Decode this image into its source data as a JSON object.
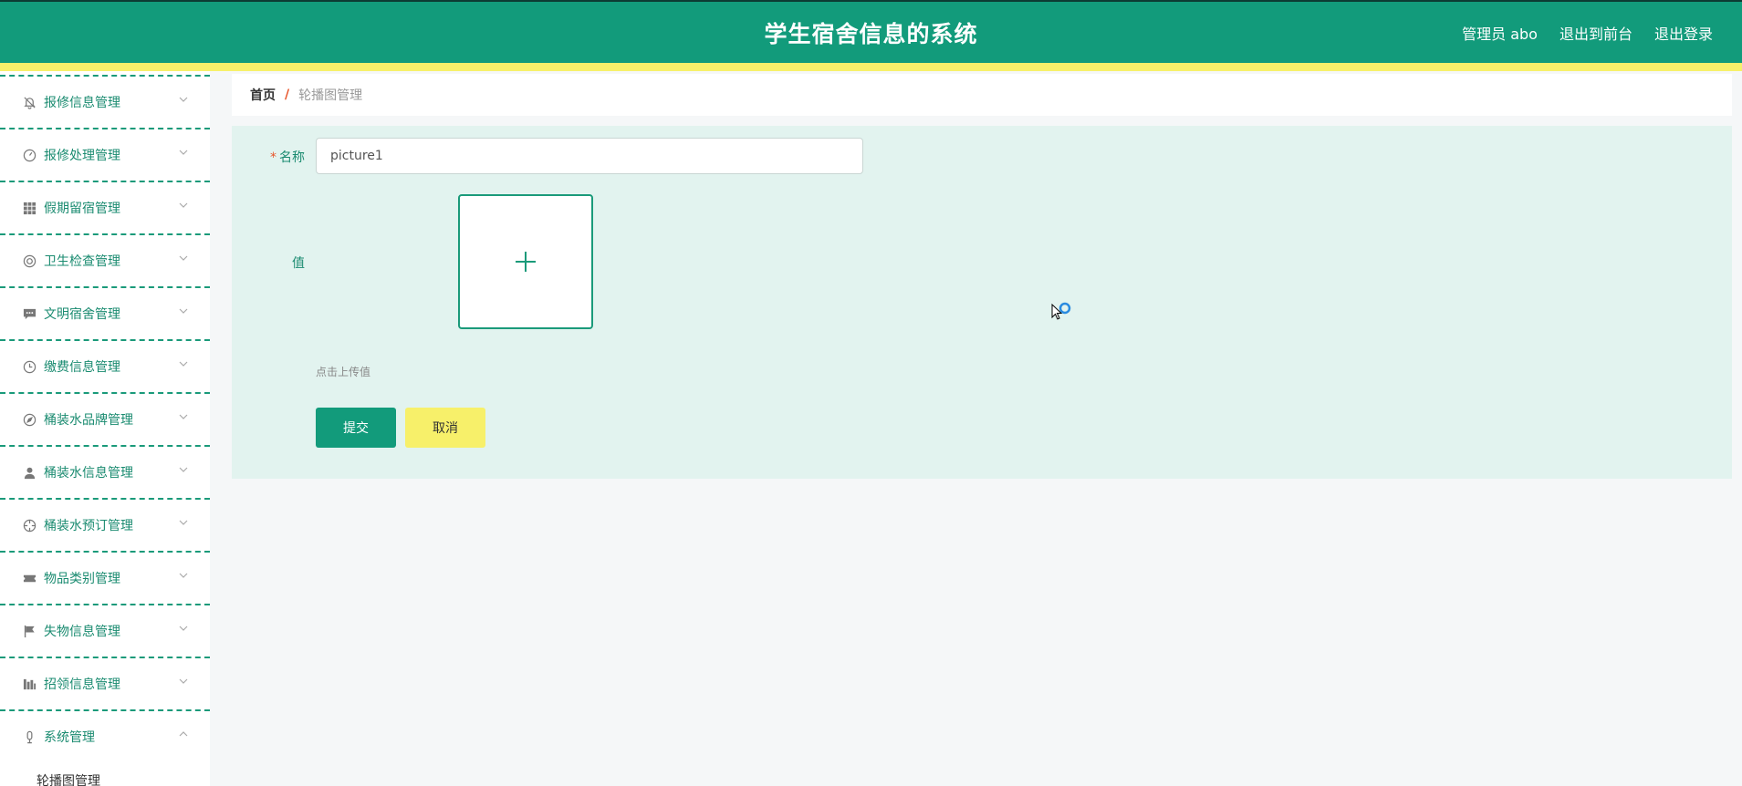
{
  "header": {
    "title": "学生宿舍信息的系统",
    "links": [
      "管理员 abo",
      "退出到前台",
      "退出登录"
    ]
  },
  "sidebar": {
    "items": [
      {
        "label": "报修信息管理",
        "icon": "bell-off-icon"
      },
      {
        "label": "报修处理管理",
        "icon": "gauge-icon"
      },
      {
        "label": "假期留宿管理",
        "icon": "grid-icon"
      },
      {
        "label": "卫生检查管理",
        "icon": "lifebuoy-icon"
      },
      {
        "label": "文明宿舍管理",
        "icon": "chat-icon"
      },
      {
        "label": "缴费信息管理",
        "icon": "clock-icon"
      },
      {
        "label": "桶装水品牌管理",
        "icon": "compass-icon"
      },
      {
        "label": "桶装水信息管理",
        "icon": "user-icon"
      },
      {
        "label": "桶装水预订管理",
        "icon": "crosshair-icon"
      },
      {
        "label": "物品类别管理",
        "icon": "ticket-icon"
      },
      {
        "label": "失物信息管理",
        "icon": "flag-icon"
      },
      {
        "label": "招领信息管理",
        "icon": "bar-chart-icon"
      },
      {
        "label": "系统管理",
        "icon": "microphone-icon",
        "expanded": true
      }
    ],
    "submenu": [
      "轮播图管理"
    ]
  },
  "breadcrumb": {
    "home": "首页",
    "separator": "/",
    "current": "轮播图管理"
  },
  "form": {
    "name_label": "名称",
    "name_required": "*",
    "name_value": "picture1",
    "value_label": "值",
    "upload_tip": "点击上传值",
    "submit_label": "提交",
    "cancel_label": "取消"
  },
  "colors": {
    "primary": "#129b7b",
    "accent_yellow": "#f7f06a",
    "panel_bg": "#e2f3ef"
  }
}
